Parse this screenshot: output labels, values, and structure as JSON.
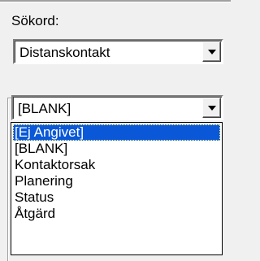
{
  "search": {
    "label": "Sökord:",
    "combo1": {
      "value": "Distanskontakt"
    },
    "combo2": {
      "value": "[BLANK]"
    }
  },
  "dropdown": {
    "options": [
      {
        "label": "[Ej Angivet]",
        "selected": true
      },
      {
        "label": "[BLANK]"
      },
      {
        "label": "Kontaktorsak"
      },
      {
        "label": "Planering"
      },
      {
        "label": "Status"
      },
      {
        "label": "Åtgärd"
      }
    ]
  },
  "colors": {
    "highlight": "#0a58d8",
    "background": "#f0f0f0"
  },
  "icons": {
    "dropdown_arrow": "chevron-down-icon"
  }
}
